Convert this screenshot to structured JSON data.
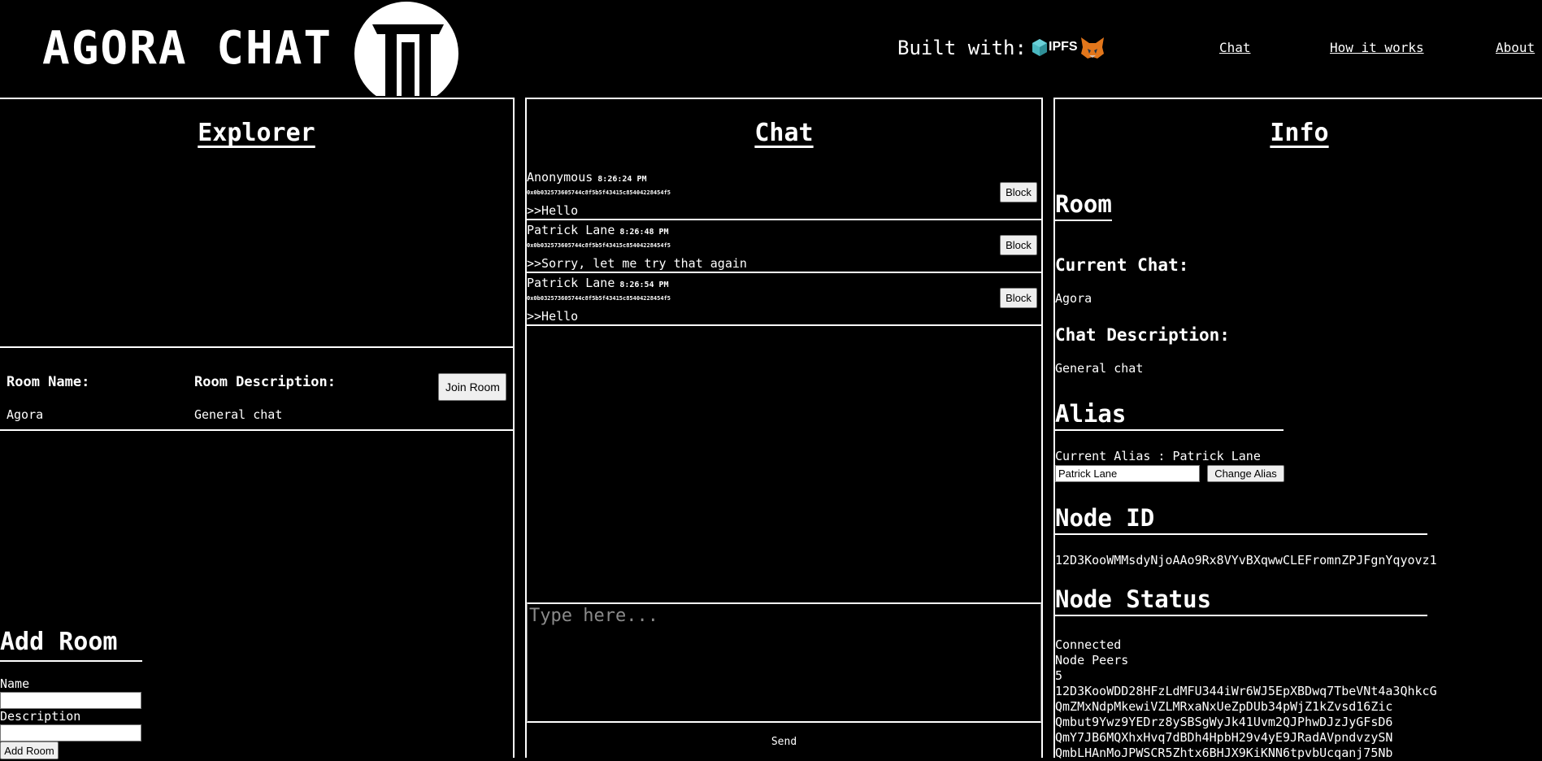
{
  "header": {
    "title": "AGORA CHAT",
    "built_with": "Built with:",
    "ipfs_label": "IPFS",
    "nav": [
      {
        "label": "Chat"
      },
      {
        "label": "How it works"
      },
      {
        "label": "About"
      }
    ]
  },
  "explorer": {
    "title": "Explorer",
    "room_name_label": "Room Name:",
    "room_description_label": "Room Description:",
    "room_name": "Agora",
    "room_description": "General chat",
    "join_label": "Join Room",
    "add_room_title": "Add Room",
    "name_label": "Name",
    "description_label": "Description",
    "add_room_button": "Add Room"
  },
  "chat": {
    "title": "Chat",
    "block_label": "Block",
    "messages": [
      {
        "author": "Anonymous",
        "time": "8:26:24 PM",
        "address": "0x0b032573605744c8f5b5f43415c85404228454f5",
        "text": ">>Hello"
      },
      {
        "author": "Patrick Lane",
        "time": "8:26:48 PM",
        "address": "0x0b032573605744c8f5b5f43415c85404228454f5",
        "text": ">>Sorry, let me try that again"
      },
      {
        "author": "Patrick Lane",
        "time": "8:26:54 PM",
        "address": "0x0b032573605744c8f5b5f43415c85404228454f5",
        "text": ">>Hello"
      }
    ],
    "input_placeholder": "Type here...",
    "send_label": "Send"
  },
  "info": {
    "title": "Info",
    "room_heading": "Room",
    "current_chat_label": "Current Chat:",
    "current_chat": "Agora",
    "chat_description_label": "Chat Description:",
    "chat_description": "General chat",
    "alias_heading": "Alias",
    "current_alias_text": "Current Alias : Patrick Lane",
    "alias_input_value": "Patrick Lane",
    "change_alias_label": "Change Alias",
    "node_id_heading": "Node ID",
    "node_id": "12D3KooWMMsdyNjoAAo9Rx8VYvBXqwwCLEFromnZPJFgnYqyovz1",
    "node_status_heading": "Node Status",
    "status": "Connected",
    "node_peers_label": "Node Peers",
    "peer_count": "5",
    "peers": [
      "12D3KooWDD28HFzLdMFU344iWr6WJ5EpXBDwq7TbeVNt4a3QhkcG",
      "QmZMxNdpMkewiVZLMRxaNxUeZpDUb34pWjZ1kZvsd16Zic",
      "Qmbut9Ywz9YEDrz8ySBSgWyJk41Uvm2QJPhwDJzJyGFsD6",
      "QmY7JB6MQXhxHvq7dBDh4HpbH29v4yE9JRadAVpndvzySN",
      "QmbLHAnMoJPWSCR5Zhtx6BHJX9KiKNN6tpvbUcqanj75Nb"
    ]
  },
  "colors": {
    "background": "#000000",
    "foreground": "#ffffff",
    "button_bg": "#efefef"
  }
}
